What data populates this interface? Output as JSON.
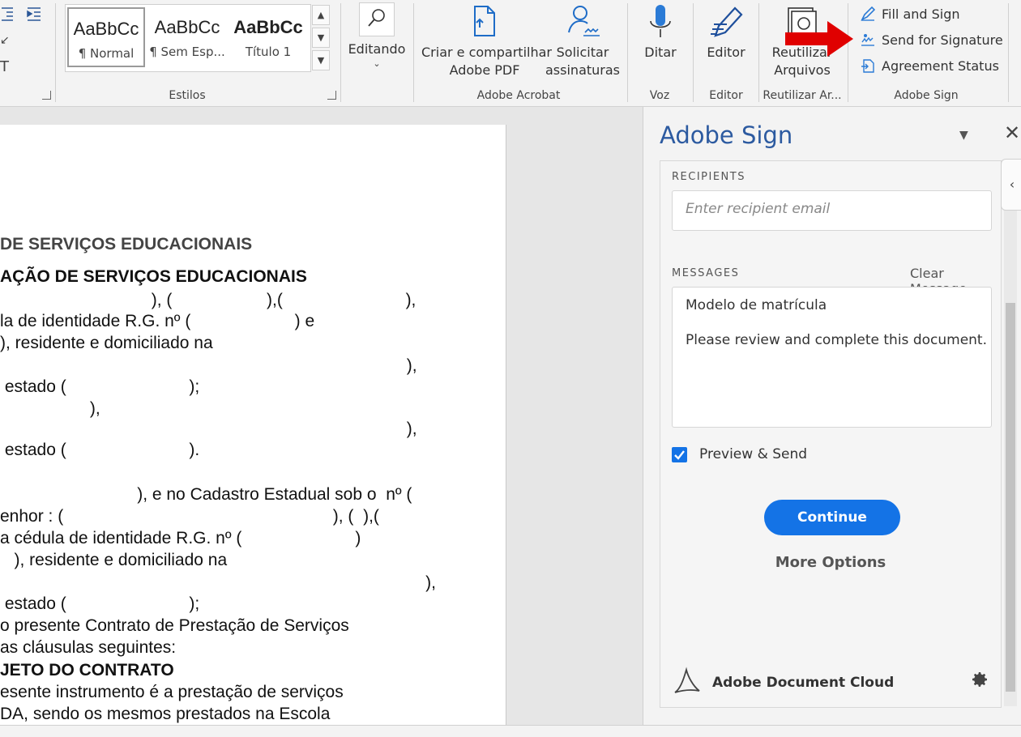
{
  "ribbon": {
    "styles": {
      "group_label": "Estilos",
      "tiles": [
        {
          "sample": "AaBbCc",
          "name": "¶ Normal"
        },
        {
          "sample": "AaBbCc",
          "name": "¶ Sem Esp..."
        },
        {
          "sample": "AaBbCc",
          "name": "Título 1"
        }
      ]
    },
    "editing": {
      "label": "Editando"
    },
    "acrobat": {
      "group_label": "Adobe Acrobat",
      "create_share_line1": "Criar e compartilhar",
      "create_share_line2": "Adobe PDF",
      "request_sign_line1": "Solicitar",
      "request_sign_line2": "assinaturas"
    },
    "voice": {
      "group_label": "Voz",
      "dictate": "Ditar"
    },
    "editor": {
      "group_label": "Editor",
      "label": "Editor"
    },
    "reuse": {
      "group_label": "Reutilizar Ar...",
      "line1": "Reutilizar",
      "line2": "Arquivos"
    },
    "adobe_sign": {
      "group_label": "Adobe Sign",
      "fill_sign": "Fill and Sign",
      "send_signature": "Send for Signature",
      "agreement_status": "Agreement Status"
    }
  },
  "document": {
    "lines": [
      "DE SERVIÇOS EDUCACIONAIS",
      "AÇÃO DE SERVIÇOS EDUCACIONAIS",
      "                                ), (                    ),(                          ),",
      "la de identidade R.G. nº (                      ) e",
      "), residente e domiciliado na",
      "                                                                                      ),",
      " estado (                          );",
      "                   ),",
      "                                                                                      ),",
      " estado (                          ).",
      "                             ), e no Cadastro Estadual sob o  nº (",
      "enhor : (                                                         ), (  ),(",
      "a cédula de identidade R.G. nº (                        )",
      "   ), residente e domiciliado na",
      "                                                                                          ),",
      " estado (                          );",
      "o presente Contrato de Prestação de Serviços",
      "as cláusulas seguintes:",
      "JETO DO CONTRATO",
      "esente instrumento é a prestação de serviços",
      "DA, sendo os mesmos prestados na Escola"
    ]
  },
  "sign_pane": {
    "title": "Adobe Sign",
    "recipients_label": "RECIPIENTS",
    "recipient_placeholder": "Enter recipient email",
    "messages_label": "MESSAGES",
    "clear_message": "Clear Message",
    "message_subject": "Modelo de matrícula",
    "message_body": "Please review and complete this document.",
    "preview_send_label": "Preview & Send",
    "preview_send_checked": true,
    "continue_label": "Continue",
    "more_options_label": "More Options",
    "footer_brand": "Adobe Document Cloud"
  },
  "colors": {
    "accent": "#1473e6",
    "pane_title": "#2c5aa0",
    "arrow": "#e00000"
  },
  "icons": [
    "indent-icon",
    "share-pdf-icon",
    "request-signature-icon",
    "microphone-icon",
    "editor-pen-icon",
    "reuse-files-icon",
    "fill-sign-icon",
    "send-signature-icon",
    "agreement-status-icon",
    "gear-icon",
    "acrobat-logo-icon",
    "close-icon"
  ]
}
